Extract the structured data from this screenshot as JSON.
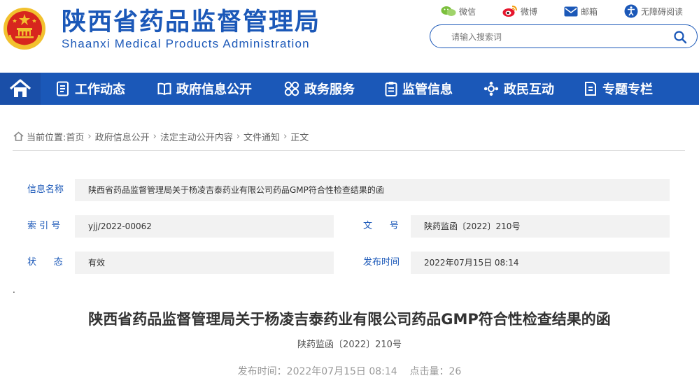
{
  "header": {
    "title_cn": "陕西省药品监督管理局",
    "title_en": "Shaanxi Medical Products Administration",
    "top_links": [
      {
        "label": "微信",
        "icon": "wechat-icon"
      },
      {
        "label": "微博",
        "icon": "weibo-icon"
      },
      {
        "label": "邮箱",
        "icon": "mail-icon"
      },
      {
        "label": "无障碍阅读",
        "icon": "accessibility-icon"
      }
    ],
    "search": {
      "placeholder": "请输入搜索词"
    }
  },
  "nav": {
    "items": [
      {
        "label": "工作动态",
        "icon": "document-list-icon"
      },
      {
        "label": "政府信息公开",
        "icon": "open-book-icon"
      },
      {
        "label": "政务服务",
        "icon": "grid-service-icon"
      },
      {
        "label": "监管信息",
        "icon": "clipboard-icon"
      },
      {
        "label": "政民互动",
        "icon": "interaction-icon"
      },
      {
        "label": "专题专栏",
        "icon": "topic-icon"
      }
    ]
  },
  "breadcrumb": {
    "prefix": "当前位置:",
    "items": [
      "首页",
      "政府信息公开",
      "法定主动公开内容",
      "文件通知",
      "正文"
    ]
  },
  "info": {
    "name_label": "信息名称",
    "name_value": "陕西省药品监督管理局关于杨凌吉泰药业有限公司药品GMP符合性检查结果的函",
    "index_label": "索 引 号",
    "index_value": "yjj/2022-00062",
    "docno_label": "文      号",
    "docno_value": "陕药监函〔2022〕210号",
    "status_label": "状      态",
    "status_value": "有效",
    "date_label": "发布时间",
    "date_value": "2022年07月15日 08:14"
  },
  "article": {
    "dot": ".",
    "title": "陕西省药品监督管理局关于杨凌吉泰药业有限公司药品GMP符合性检查结果的函",
    "doc_no": "陕药监函〔2022〕210号",
    "meta": "发布时间：2022年07月15日 08:14    点击量：26"
  },
  "colors": {
    "brand_blue": "#1b58b8",
    "emblem_red": "#d7261e",
    "emblem_gold": "#f2c12e",
    "info_bg": "#f2f2f2"
  }
}
